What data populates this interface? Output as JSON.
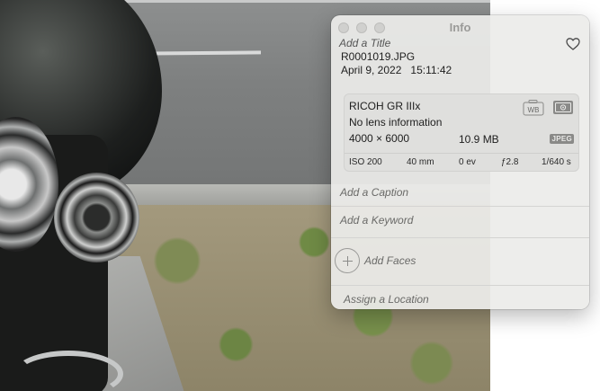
{
  "window": {
    "title": "Info"
  },
  "photo_info": {
    "title_placeholder": "Add a Title",
    "filename": "R0001019.JPG",
    "date": "April 9, 2022",
    "time": "15:11:42"
  },
  "camera": {
    "model": "RICOH GR IIIx",
    "lens": "No lens information",
    "dimensions": "4000 × 6000",
    "file_size": "10.9 MB",
    "format_badge": "JPEG",
    "wb_icon_label": "WB",
    "exif": {
      "iso": "ISO 200",
      "focal_length": "40 mm",
      "exposure_bias": "0 ev",
      "aperture": "ƒ2.8",
      "shutter": "1/640 s"
    }
  },
  "fields": {
    "caption_placeholder": "Add a Caption",
    "keyword_placeholder": "Add a Keyword",
    "faces_label": "Add Faces",
    "location_placeholder": "Assign a Location"
  },
  "icons": {
    "favorite": "heart-icon",
    "white_balance": "camera-wb-icon",
    "metering": "metering-icon",
    "add_faces": "plus-circle-icon"
  }
}
